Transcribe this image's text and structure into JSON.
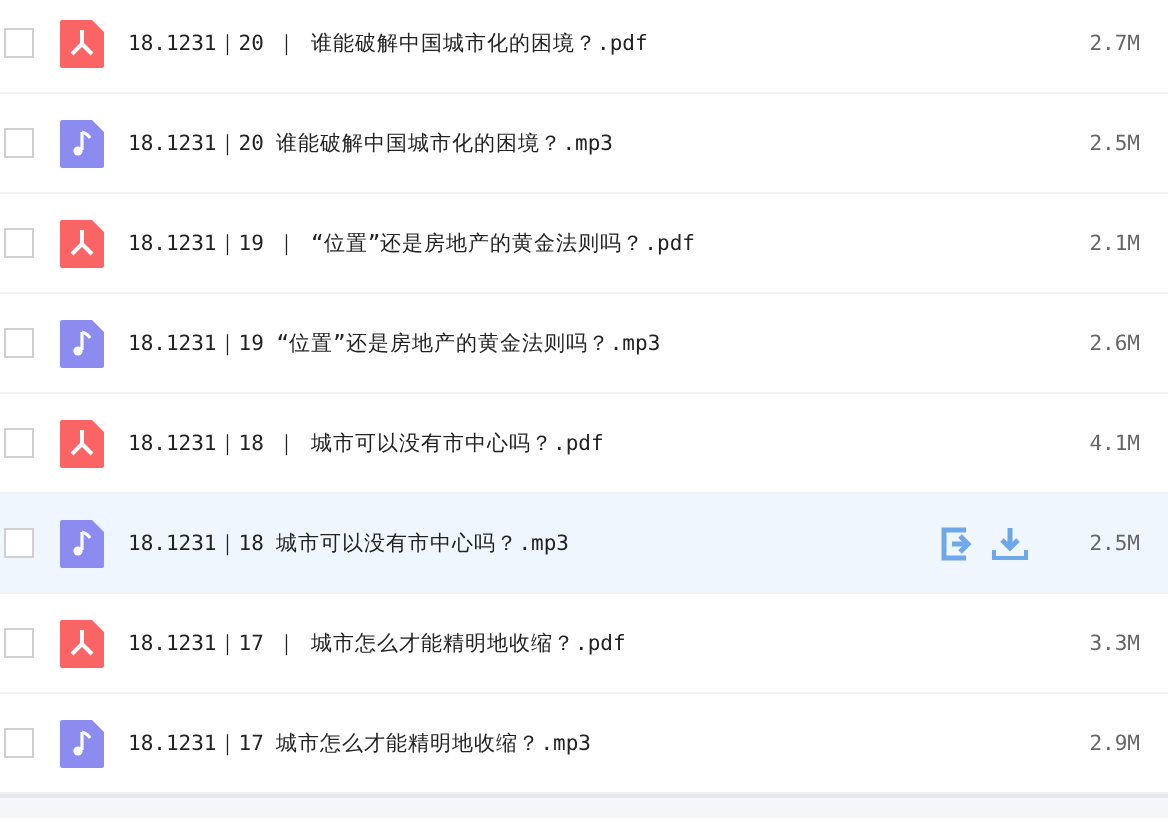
{
  "files": [
    {
      "name": "18.1231｜20 ｜ 谁能破解中国城市化的困境？.pdf",
      "kind": "pdf",
      "size": "2.7M",
      "checked": false,
      "hovered": false
    },
    {
      "name": "18.1231｜20 谁能破解中国城市化的困境？.mp3",
      "kind": "audio",
      "size": "2.5M",
      "checked": false,
      "hovered": false
    },
    {
      "name": "18.1231｜19 ｜ “位置”还是房地产的黄金法则吗？.pdf",
      "kind": "pdf",
      "size": "2.1M",
      "checked": false,
      "hovered": false
    },
    {
      "name": "18.1231｜19 “位置”还是房地产的黄金法则吗？.mp3",
      "kind": "audio",
      "size": "2.6M",
      "checked": false,
      "hovered": false
    },
    {
      "name": "18.1231｜18 ｜ 城市可以没有市中心吗？.pdf",
      "kind": "pdf",
      "size": "4.1M",
      "checked": false,
      "hovered": false
    },
    {
      "name": "18.1231｜18 城市可以没有市中心吗？.mp3",
      "kind": "audio",
      "size": "2.5M",
      "checked": false,
      "hovered": true
    },
    {
      "name": "18.1231｜17 ｜ 城市怎么才能精明地收缩？.pdf",
      "kind": "pdf",
      "size": "3.3M",
      "checked": false,
      "hovered": false
    },
    {
      "name": "18.1231｜17 城市怎么才能精明地收缩？.mp3",
      "kind": "audio",
      "size": "2.9M",
      "checked": false,
      "hovered": false
    }
  ]
}
